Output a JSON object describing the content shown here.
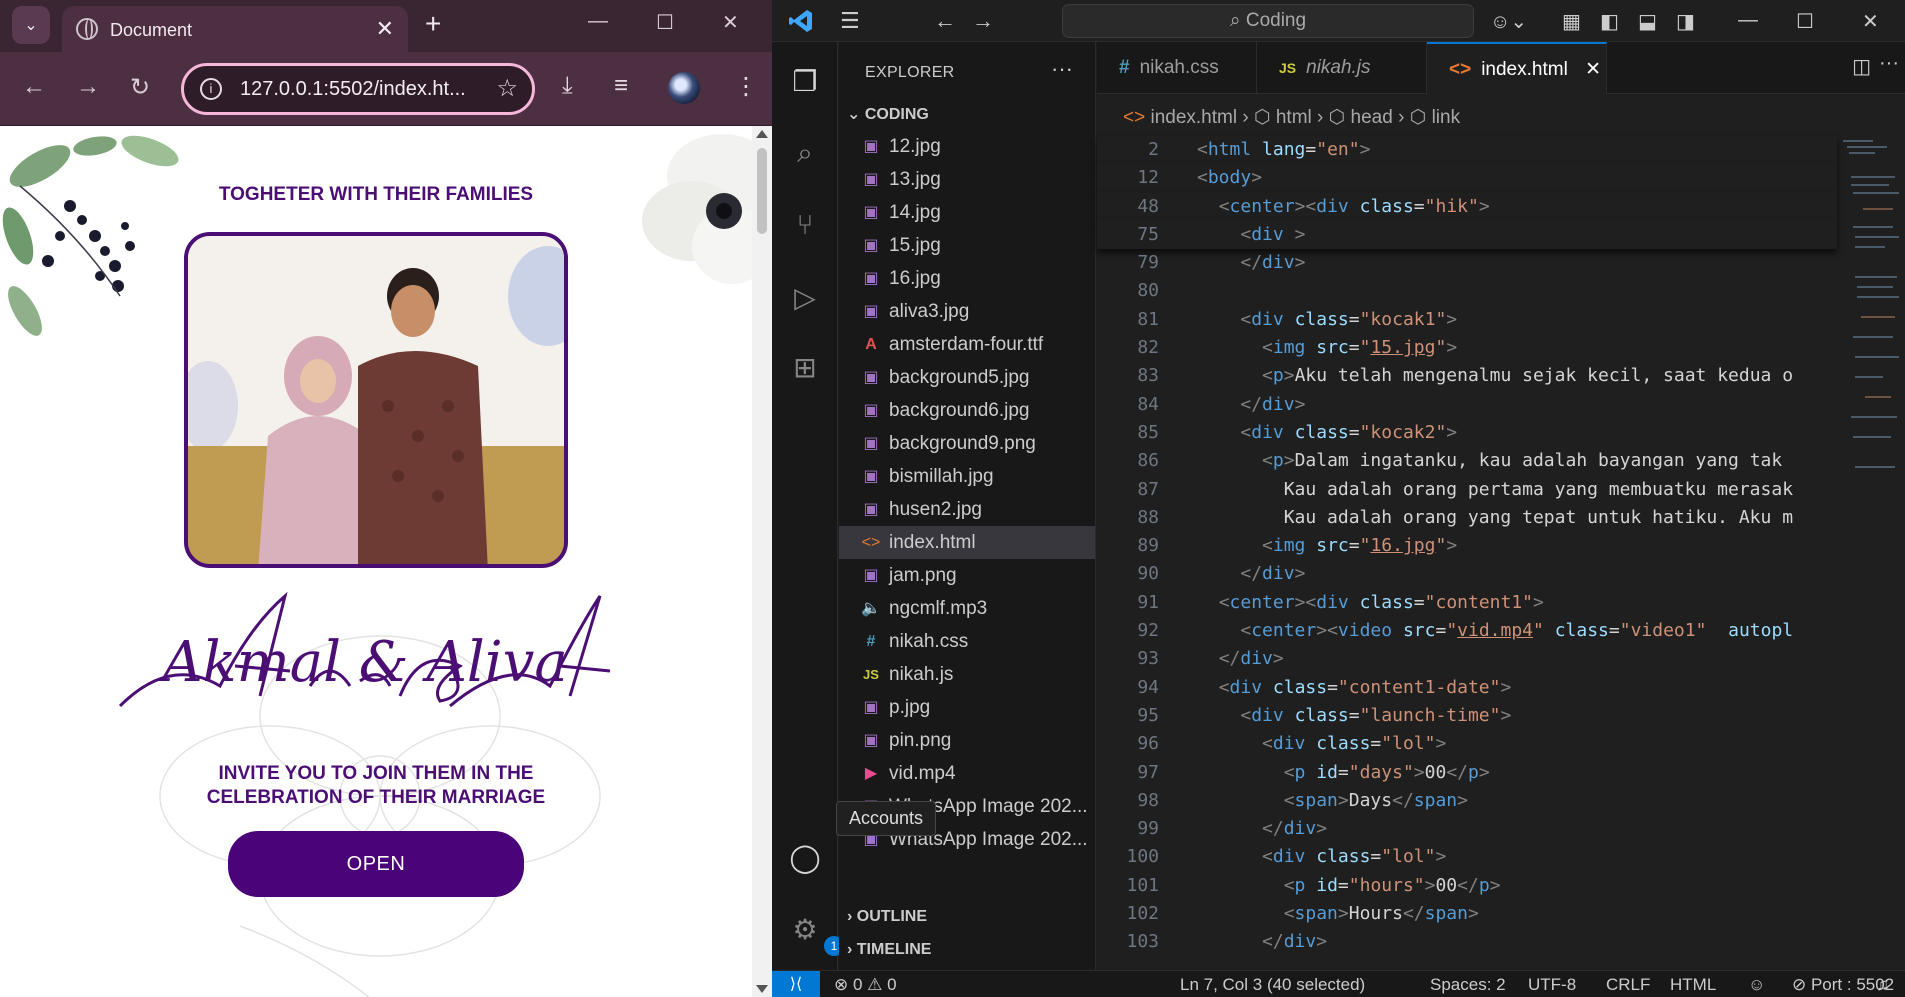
{
  "browser": {
    "tab_title": "Document",
    "url": "127.0.0.1:5502/index.ht...",
    "page": {
      "heading": "TOGHETER WITH THEIR FAMILIES",
      "names": "Akmal & Aliva",
      "invite_line1": "INVITE YOU TO JOIN THEM IN THE",
      "invite_line2": "CELEBRATION OF THEIR MARRIAGE",
      "open_label": "OPEN",
      "accent_color": "#4a0378"
    }
  },
  "vscode": {
    "search_text": "Coding",
    "explorer_title": "EXPLORER",
    "folder": "CODING",
    "files": [
      {
        "name": "12.jpg",
        "type": "img"
      },
      {
        "name": "13.jpg",
        "type": "img"
      },
      {
        "name": "14.jpg",
        "type": "img"
      },
      {
        "name": "15.jpg",
        "type": "img"
      },
      {
        "name": "16.jpg",
        "type": "img"
      },
      {
        "name": "aliva3.jpg",
        "type": "img"
      },
      {
        "name": "amsterdam-four.ttf",
        "type": "font"
      },
      {
        "name": "background5.jpg",
        "type": "img"
      },
      {
        "name": "background6.jpg",
        "type": "img"
      },
      {
        "name": "background9.png",
        "type": "img"
      },
      {
        "name": "bismillah.jpg",
        "type": "img"
      },
      {
        "name": "husen2.jpg",
        "type": "img"
      },
      {
        "name": "index.html",
        "type": "html"
      },
      {
        "name": "jam.png",
        "type": "img"
      },
      {
        "name": "ngcmlf.mp3",
        "type": "audio"
      },
      {
        "name": "nikah.css",
        "type": "css"
      },
      {
        "name": "nikah.js",
        "type": "js"
      },
      {
        "name": "p.jpg",
        "type": "img"
      },
      {
        "name": "pin.png",
        "type": "img"
      },
      {
        "name": "vid.mp4",
        "type": "video"
      },
      {
        "name": "WhatsApp Image 202...",
        "type": "img"
      },
      {
        "name": "WhatsApp Image 202...",
        "type": "img"
      }
    ],
    "outline_label": "OUTLINE",
    "timeline_label": "TIMELINE",
    "accounts_tooltip": "Accounts",
    "settings_badge": "1",
    "tabs": [
      {
        "icon": "#",
        "label": "nikah.css"
      },
      {
        "icon": "JS",
        "label": "nikah.js"
      },
      {
        "icon": "<>",
        "label": "index.html"
      }
    ],
    "breadcrumb": [
      "index.html",
      "html",
      "head",
      "link"
    ],
    "code_lines": [
      {
        "n": "2",
        "h": "<span class='t-punc'>&lt;</span><span class='t-tag'>html</span> <span class='t-attr'>lang</span>=<span class='t-str'>\"en\"</span><span class='t-punc'>&gt;</span>",
        "indent": 0,
        "sticky": true
      },
      {
        "n": "12",
        "h": "<span class='t-punc'>&lt;</span><span class='t-tag'>body</span><span class='t-punc'>&gt;</span>",
        "indent": 0,
        "sticky": true
      },
      {
        "n": "48",
        "h": "  <span class='t-punc'>&lt;</span><span class='t-tag'>center</span><span class='t-punc'>&gt;&lt;</span><span class='t-tag'>div</span> <span class='t-attr'>class</span>=<span class='t-str'>\"hik\"</span><span class='t-punc'>&gt;</span>",
        "indent": 0,
        "sticky": true
      },
      {
        "n": "75",
        "h": "    <span class='t-punc'>&lt;</span><span class='t-tag'>div</span> <span class='t-punc'>&gt;</span>",
        "indent": 0,
        "sticky": true
      },
      {
        "n": "79",
        "h": "    <span class='t-punc'>&lt;/</span><span class='t-tag'>div</span><span class='t-punc'>&gt;</span>"
      },
      {
        "n": "80",
        "h": ""
      },
      {
        "n": "81",
        "h": "    <span class='t-punc'>&lt;</span><span class='t-tag'>div</span> <span class='t-attr'>class</span>=<span class='t-str'>\"kocak1\"</span><span class='t-punc'>&gt;</span>"
      },
      {
        "n": "82",
        "h": "      <span class='t-punc'>&lt;</span><span class='t-tag'>img</span> <span class='t-attr'>src</span>=<span class='t-str'>\"<u>15.jpg</u>\"</span><span class='t-punc'>&gt;</span>"
      },
      {
        "n": "83",
        "h": "      <span class='t-punc'>&lt;</span><span class='t-tag'>p</span><span class='t-punc'>&gt;</span>Aku telah mengenalmu sejak kecil, saat kedua o"
      },
      {
        "n": "84",
        "h": "    <span class='t-punc'>&lt;/</span><span class='t-tag'>div</span><span class='t-punc'>&gt;</span>"
      },
      {
        "n": "85",
        "h": "    <span class='t-punc'>&lt;</span><span class='t-tag'>div</span> <span class='t-attr'>class</span>=<span class='t-str'>\"kocak2\"</span><span class='t-punc'>&gt;</span>"
      },
      {
        "n": "86",
        "h": "      <span class='t-punc'>&lt;</span><span class='t-tag'>p</span><span class='t-punc'>&gt;</span>Dalam ingatanku, kau adalah bayangan yang tak"
      },
      {
        "n": "87",
        "h": "        Kau adalah orang pertama yang membuatku merasak"
      },
      {
        "n": "88",
        "h": "        Kau adalah orang yang tepat untuk hatiku. Aku m"
      },
      {
        "n": "89",
        "h": "      <span class='t-punc'>&lt;</span><span class='t-tag'>img</span> <span class='t-attr'>src</span>=<span class='t-str'>\"<u>16.jpg</u>\"</span><span class='t-punc'>&gt;</span>"
      },
      {
        "n": "90",
        "h": "    <span class='t-punc'>&lt;/</span><span class='t-tag'>div</span><span class='t-punc'>&gt;</span>"
      },
      {
        "n": "91",
        "h": "  <span class='t-punc'>&lt;</span><span class='t-tag'>center</span><span class='t-punc'>&gt;&lt;</span><span class='t-tag'>div</span> <span class='t-attr'>class</span>=<span class='t-str'>\"content1\"</span><span class='t-punc'>&gt;</span>"
      },
      {
        "n": "92",
        "h": "    <span class='t-punc'>&lt;</span><span class='t-tag'>center</span><span class='t-punc'>&gt;&lt;</span><span class='t-tag'>video</span> <span class='t-attr'>src</span>=<span class='t-str'>\"<u>vid.mp4</u>\"</span> <span class='t-attr'>class</span>=<span class='t-str'>\"video1\"</span>  <span class='t-attr'>autopl</span>"
      },
      {
        "n": "93",
        "h": "  <span class='t-punc'>&lt;/</span><span class='t-tag'>div</span><span class='t-punc'>&gt;</span>"
      },
      {
        "n": "94",
        "h": "  <span class='t-punc'>&lt;</span><span class='t-tag'>div</span> <span class='t-attr'>class</span>=<span class='t-str'>\"content1-date\"</span><span class='t-punc'>&gt;</span>"
      },
      {
        "n": "95",
        "h": "    <span class='t-punc'>&lt;</span><span class='t-tag'>div</span> <span class='t-attr'>class</span>=<span class='t-str'>\"launch-time\"</span><span class='t-punc'>&gt;</span>"
      },
      {
        "n": "96",
        "h": "      <span class='t-punc'>&lt;</span><span class='t-tag'>div</span> <span class='t-attr'>class</span>=<span class='t-str'>\"lol\"</span><span class='t-punc'>&gt;</span>"
      },
      {
        "n": "97",
        "h": "        <span class='t-punc'>&lt;</span><span class='t-tag'>p</span> <span class='t-attr'>id</span>=<span class='t-str'>\"days\"</span><span class='t-punc'>&gt;</span>00<span class='t-punc'>&lt;/</span><span class='t-tag'>p</span><span class='t-punc'>&gt;</span>"
      },
      {
        "n": "98",
        "h": "        <span class='t-punc'>&lt;</span><span class='t-tag'>span</span><span class='t-punc'>&gt;</span>Days<span class='t-punc'>&lt;/</span><span class='t-tag'>span</span><span class='t-punc'>&gt;</span>"
      },
      {
        "n": "99",
        "h": "      <span class='t-punc'>&lt;/</span><span class='t-tag'>div</span><span class='t-punc'>&gt;</span>"
      },
      {
        "n": "100",
        "h": "      <span class='t-punc'>&lt;</span><span class='t-tag'>div</span> <span class='t-attr'>class</span>=<span class='t-str'>\"lol\"</span><span class='t-punc'>&gt;</span>"
      },
      {
        "n": "101",
        "h": "        <span class='t-punc'>&lt;</span><span class='t-tag'>p</span> <span class='t-attr'>id</span>=<span class='t-str'>\"hours\"</span><span class='t-punc'>&gt;</span>00<span class='t-punc'>&lt;/</span><span class='t-tag'>p</span><span class='t-punc'>&gt;</span>"
      },
      {
        "n": "102",
        "h": "        <span class='t-punc'>&lt;</span><span class='t-tag'>span</span><span class='t-punc'>&gt;</span>Hours<span class='t-punc'>&lt;/</span><span class='t-tag'>span</span><span class='t-punc'>&gt;</span>"
      },
      {
        "n": "103",
        "h": "      <span class='t-punc'>&lt;/</span><span class='t-tag'>div</span><span class='t-punc'>&gt;</span>"
      }
    ],
    "status": {
      "errors": "0",
      "warnings": "0",
      "position": "Ln 7, Col 3 (40 selected)",
      "spaces": "Spaces: 2",
      "encoding": "UTF-8",
      "eol": "CRLF",
      "language": "HTML",
      "port": "Port : 5502"
    }
  }
}
